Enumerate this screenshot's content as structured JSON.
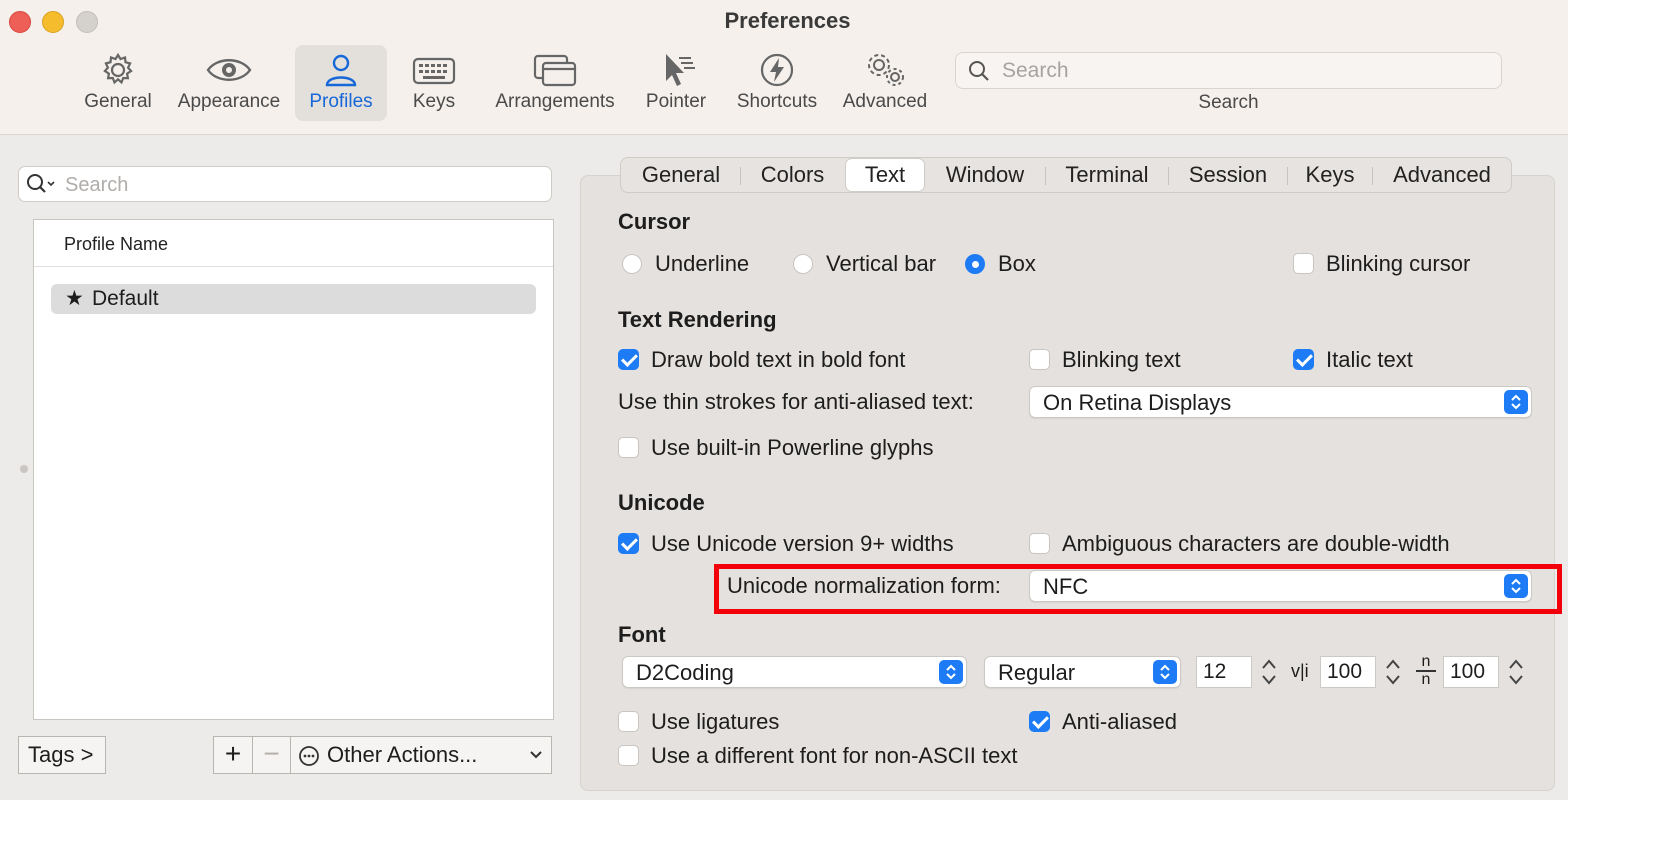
{
  "window": {
    "title": "Preferences"
  },
  "toolbar": {
    "items": [
      {
        "label": "General",
        "icon": "gear-icon"
      },
      {
        "label": "Appearance",
        "icon": "eye-icon"
      },
      {
        "label": "Profiles",
        "icon": "person-icon",
        "selected": true
      },
      {
        "label": "Keys",
        "icon": "keyboard-icon"
      },
      {
        "label": "Arrangements",
        "icon": "windows-icon"
      },
      {
        "label": "Pointer",
        "icon": "pointer-icon"
      },
      {
        "label": "Shortcuts",
        "icon": "bolt-icon"
      },
      {
        "label": "Advanced",
        "icon": "gears-icon"
      }
    ],
    "search": {
      "placeholder": "Search",
      "label": "Search"
    }
  },
  "sidebar": {
    "search_placeholder": "Search",
    "column_header": "Profile Name",
    "profiles": [
      {
        "name": "Default",
        "default": true
      }
    ],
    "tags_button": "Tags >",
    "add_button": "+",
    "remove_button": "−",
    "other_actions": "Other Actions..."
  },
  "tabs": [
    {
      "label": "General"
    },
    {
      "label": "Colors"
    },
    {
      "label": "Text",
      "selected": true
    },
    {
      "label": "Window"
    },
    {
      "label": "Terminal"
    },
    {
      "label": "Session"
    },
    {
      "label": "Keys"
    },
    {
      "label": "Advanced"
    }
  ],
  "cursor": {
    "heading": "Cursor",
    "options": [
      {
        "label": "Underline",
        "checked": false
      },
      {
        "label": "Vertical bar",
        "checked": false
      },
      {
        "label": "Box",
        "checked": true
      }
    ],
    "blinking": {
      "label": "Blinking cursor",
      "checked": false
    }
  },
  "text_rendering": {
    "heading": "Text Rendering",
    "draw_bold": {
      "label": "Draw bold text in bold font",
      "checked": true
    },
    "blinking_text": {
      "label": "Blinking text",
      "checked": false
    },
    "italic_text": {
      "label": "Italic text",
      "checked": true
    },
    "thin_strokes_label": "Use thin strokes for anti-aliased text:",
    "thin_strokes_value": "On Retina Displays",
    "powerline": {
      "label": "Use built-in Powerline glyphs",
      "checked": false
    }
  },
  "unicode": {
    "heading": "Unicode",
    "v9_widths": {
      "label": "Use Unicode version 9+ widths",
      "checked": true
    },
    "ambiguous": {
      "label": "Ambiguous characters are double-width",
      "checked": false
    },
    "normalization_label": "Unicode normalization form:",
    "normalization_value": "NFC"
  },
  "font": {
    "heading": "Font",
    "family": "D2Coding",
    "style": "Regular",
    "size": "12",
    "h_spacing_symbol": "v|i",
    "h_spacing": "100",
    "v_spacing_symbol_top": "n",
    "v_spacing_symbol_bottom": "n",
    "v_spacing": "100",
    "ligatures": {
      "label": "Use ligatures",
      "checked": false
    },
    "anti_aliased": {
      "label": "Anti-aliased",
      "checked": true
    },
    "non_ascii": {
      "label": "Use a different font for non-ASCII text",
      "checked": false
    }
  },
  "colors": {
    "accent": "#1d7bf5",
    "highlight_box": "#f4000a",
    "selected_label": "#1668d9"
  }
}
